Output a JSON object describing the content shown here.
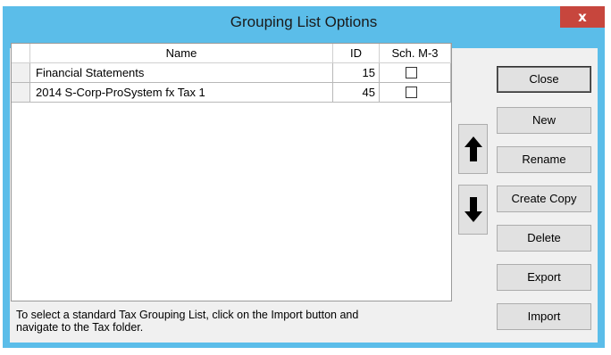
{
  "window": {
    "title": "Grouping List Options",
    "close_glyph": "x"
  },
  "grid": {
    "columns": [
      "Name",
      "ID",
      "Sch. M-3"
    ],
    "rows": [
      {
        "name": "Financial Statements",
        "id": "15",
        "sch_m3": false
      },
      {
        "name": "2014 S-Corp-ProSystem fx Tax 1",
        "id": "45",
        "sch_m3": false
      }
    ]
  },
  "footer": {
    "line1": "To select a standard Tax Grouping List, click on the Import button and",
    "line2": "navigate to the Tax folder."
  },
  "arrows": {
    "up_icon": "arrow-up-icon",
    "down_icon": "arrow-down-icon"
  },
  "buttons": {
    "close": "Close",
    "new": "New",
    "rename": "Rename",
    "create_copy": "Create Copy",
    "delete": "Delete",
    "export": "Export",
    "import": "Import"
  },
  "colors": {
    "titlebar": "#5bbde9",
    "close_button": "#c7463d",
    "client": "#f0f0f0"
  }
}
